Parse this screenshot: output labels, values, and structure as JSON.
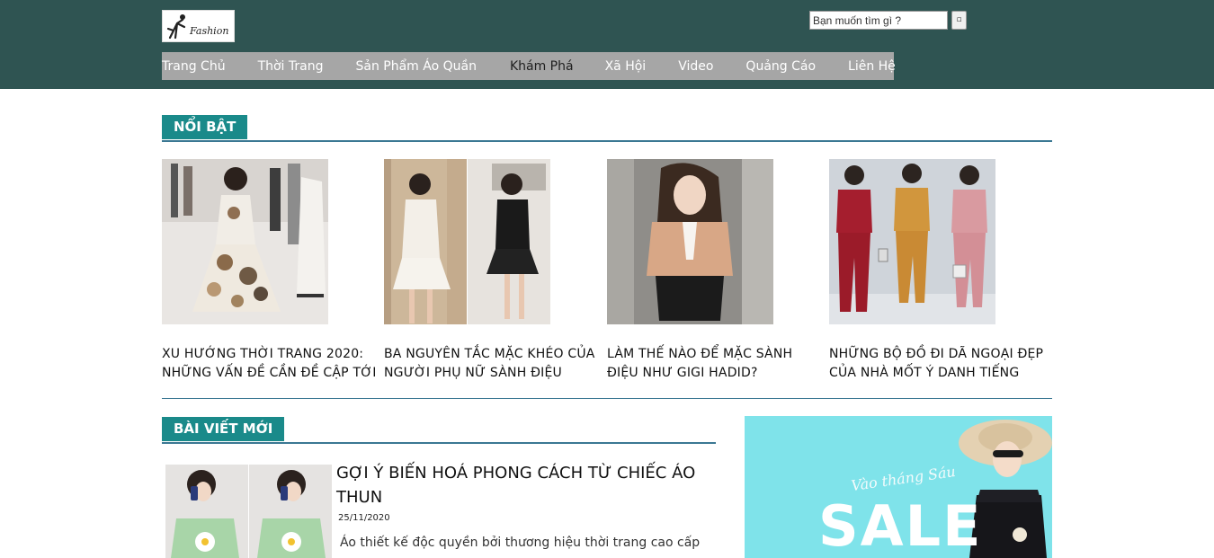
{
  "header": {
    "logo_text": "Fashion",
    "search_placeholder": "Bạn muốn tìm gì ?",
    "search_button": "▫"
  },
  "nav": {
    "items": [
      {
        "label": "Trang Chủ"
      },
      {
        "label": "Thời Trang"
      },
      {
        "label": "Sản Phẩm Áo Quần"
      },
      {
        "label": "Khám Phá",
        "active": true
      },
      {
        "label": "Xã Hội"
      },
      {
        "label": "Video"
      },
      {
        "label": "Quảng Cáo"
      },
      {
        "label": "Liên Hệ"
      }
    ]
  },
  "featured": {
    "heading": "NỔI BẬT",
    "cards": [
      {
        "title": "XU HƯỚNG THỜI TRANG 2020: NHỮNG VẤN ĐỀ CẦN ĐỀ CẬP TỚI"
      },
      {
        "title": "BA NGUYÊN TẮC MẶC KHÉO CỦA NGƯỜI PHỤ NỮ SÀNH ĐIỆU"
      },
      {
        "title": "LÀM THẾ NÀO ĐỂ MẶC SÀNH ĐIỆU NHƯ GIGI HADID?"
      },
      {
        "title": "NHỮNG BỘ ĐỒ ĐI DÃ NGOẠI ĐẸP CỦA NHÀ MỐT Ý DANH TIẾNG"
      }
    ]
  },
  "latest": {
    "heading": "BÀI VIẾT MỚI",
    "post": {
      "title": "GỢI Ý BIẾN HOÁ PHONG CÁCH TỪ CHIẾC ÁO THUN",
      "date": "25/11/2020",
      "excerpt": "Áo thiết kế độc quyền bởi thương hiệu thời trang cao cấp"
    }
  },
  "ad": {
    "script_text": "Vào tháng Sáu",
    "sale_text": "SALE"
  },
  "colors": {
    "header_bg": "#2f5452",
    "nav_bg": "#a6a6a6",
    "section_tag": "#1a8a8a",
    "rule": "#3b7893",
    "ad_bg": "#7fe3ea"
  }
}
